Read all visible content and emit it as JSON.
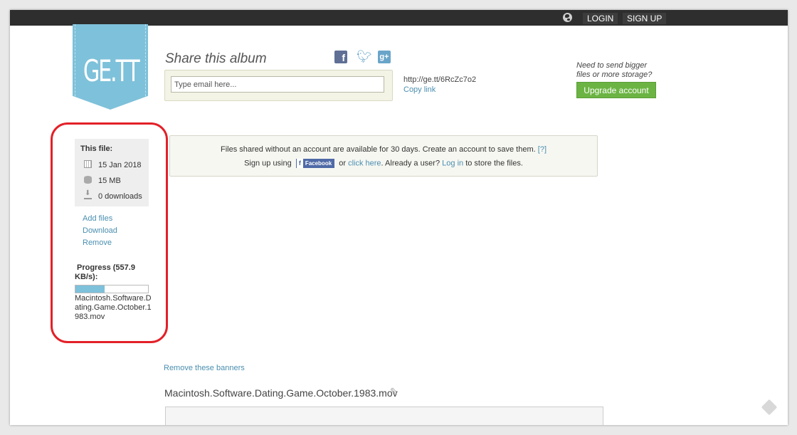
{
  "header": {
    "login_label": "LOGIN",
    "signup_label": "SIGN UP"
  },
  "logo": {
    "text": "GE.TT"
  },
  "share": {
    "title": "Share this album",
    "email_placeholder": "Type email here...",
    "url": "http://ge.tt/6RcZc7o2",
    "copy_link_label": "Copy link",
    "social": {
      "facebook_glyph": "f",
      "googleplus_glyph": "g+"
    }
  },
  "upgrade": {
    "prompt_line1": "Need to send bigger",
    "prompt_line2": "files or more storage?",
    "button_label": "Upgrade account"
  },
  "notice": {
    "line1": "Files shared without an account are available for 30 days. Create an account to save them.",
    "help_label": "[?]",
    "signup_prefix": "Sign up using",
    "facebook_label": "Facebook",
    "or_text": "or",
    "click_here_label": "click here",
    "already_text": ". Already a user?",
    "login_label": "Log in",
    "suffix": "to store the files."
  },
  "file_info": {
    "title": "This file:",
    "date": "15 Jan 2018",
    "size": "15 MB",
    "downloads": "0 downloads"
  },
  "actions": {
    "add_files": "Add files",
    "download": "Download",
    "remove": "Remove"
  },
  "progress": {
    "label": "Progress (557.9 KB/s):",
    "fraction": 0.4,
    "filename": "Macintosh.Software.Dating.Game.October.1983.mov"
  },
  "remove_banners_label": "Remove these banners",
  "file_title": "Macintosh.Software.Dating.Game.October.1983.mov",
  "colors": {
    "accent_blue": "#7ec1da",
    "link": "#4a8fb0",
    "upgrade_green": "#6bb443",
    "highlight_red": "#e32028"
  }
}
